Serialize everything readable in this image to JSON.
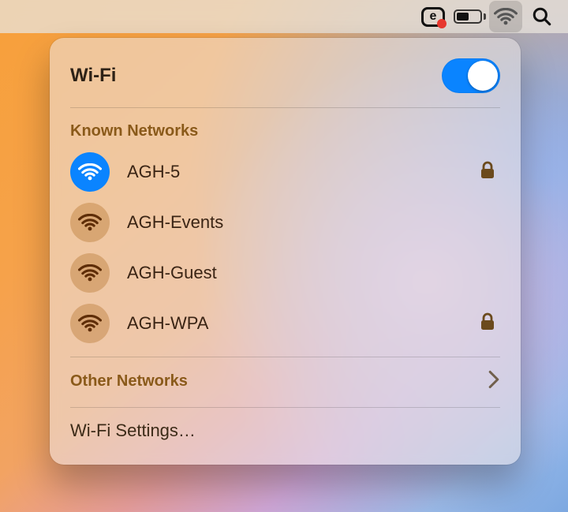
{
  "menubar": {
    "extra_app_letter": "e",
    "battery_percent": 55
  },
  "wifi": {
    "title": "Wi-Fi",
    "enabled": true,
    "known_heading": "Known Networks",
    "networks": [
      {
        "name": "AGH-5",
        "connected": true,
        "locked": true
      },
      {
        "name": "AGH-Events",
        "connected": false,
        "locked": false
      },
      {
        "name": "AGH-Guest",
        "connected": false,
        "locked": false
      },
      {
        "name": "AGH-WPA",
        "connected": false,
        "locked": true
      }
    ],
    "other_label": "Other Networks",
    "settings_label": "Wi-Fi Settings…"
  }
}
